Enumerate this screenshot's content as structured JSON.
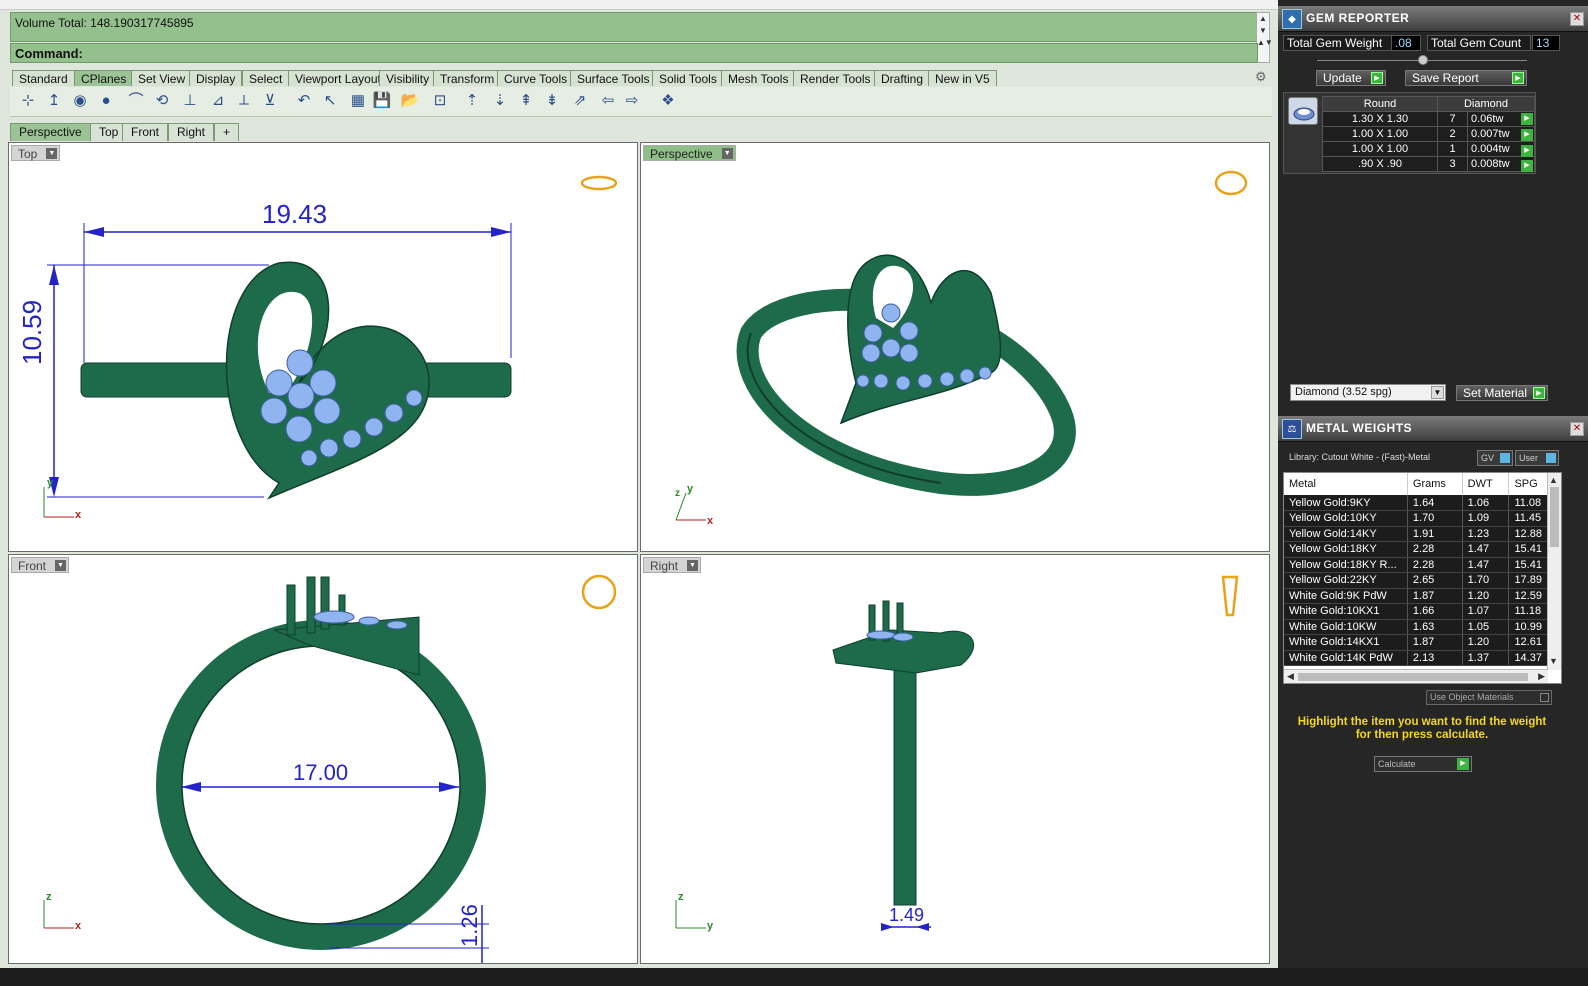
{
  "command": {
    "history": "Volume Total: 148.190317745895",
    "prompt": "Command:"
  },
  "toolbar_tabs": [
    "Standard",
    "CPlanes",
    "Set View",
    "Display",
    "Select",
    "Viewport Layout",
    "Visibility",
    "Transform",
    "Curve Tools",
    "Surface Tools",
    "Solid Tools",
    "Mesh Tools",
    "Render Tools",
    "Drafting",
    "New in V5"
  ],
  "toolbar_active": "CPlanes",
  "viewport_tabs": [
    "Perspective",
    "Top",
    "Front",
    "Right"
  ],
  "viewport_add": "+",
  "viewports": {
    "top": {
      "label": "Top",
      "dim_width": "19.43",
      "dim_height": "10.59",
      "axis_a": "y",
      "axis_b": "x"
    },
    "perspective": {
      "label": "Perspective",
      "axis_a": "z",
      "axis_b": "y",
      "axis_c": "x"
    },
    "front": {
      "label": "Front",
      "dim_inner": "17.00",
      "dim_band": "1.26",
      "axis_a": "z",
      "axis_b": "x"
    },
    "right": {
      "label": "Right",
      "dim_width": "1.49",
      "axis_a": "z",
      "axis_b": "y"
    }
  },
  "colors": {
    "metal": "#1e6b4b",
    "gem": "#8fb4f0",
    "dimension": "#2323c8",
    "panel": "#262626",
    "accent_green": "#3fb33f",
    "hint_yellow": "#f4d81b"
  },
  "gem_reporter": {
    "title": "GEM REPORTER",
    "total_weight_label": "Total Gem Weight",
    "total_weight": ".08",
    "total_count_label": "Total Gem Count",
    "total_count": "13",
    "update_label": "Update",
    "save_report_label": "Save Report",
    "table_head": [
      "Round",
      "Diamond"
    ],
    "rows": [
      {
        "size": "1.30 X 1.30",
        "count": "7",
        "weight": "0.06tw"
      },
      {
        "size": "1.00 X 1.00",
        "count": "2",
        "weight": "0.007tw"
      },
      {
        "size": "1.00 X 1.00",
        "count": "1",
        "weight": "0.004tw"
      },
      {
        "size": ".90 X .90",
        "count": "3",
        "weight": "0.008tw"
      }
    ],
    "material": "Diamond    (3.52 spg)",
    "set_material_label": "Set Material"
  },
  "metal_weights": {
    "title": "METAL WEIGHTS",
    "library": "Library: Cutout White - (Fast)-Metal",
    "gv_label": "GV",
    "user_label": "User",
    "columns": [
      "Metal",
      "Grams",
      "DWT",
      "SPG"
    ],
    "rows": [
      [
        "Yellow Gold:9KY",
        "1.64",
        "1.06",
        "11.08"
      ],
      [
        "Yellow Gold:10KY",
        "1.70",
        "1.09",
        "11.45"
      ],
      [
        "Yellow Gold:14KY",
        "1.91",
        "1.23",
        "12.88"
      ],
      [
        "Yellow Gold:18KY",
        "2.28",
        "1.47",
        "15.41"
      ],
      [
        "Yellow Gold:18KY R...",
        "2.28",
        "1.47",
        "15.41"
      ],
      [
        "Yellow Gold:22KY",
        "2.65",
        "1.70",
        "17.89"
      ],
      [
        "White Gold:9K PdW",
        "1.87",
        "1.20",
        "12.59"
      ],
      [
        "White Gold:10KX1",
        "1.66",
        "1.07",
        "11.18"
      ],
      [
        "White Gold:10KW",
        "1.63",
        "1.05",
        "10.99"
      ],
      [
        "White Gold:14KX1",
        "1.87",
        "1.20",
        "12.61"
      ],
      [
        "White Gold:14K PdW",
        "2.13",
        "1.37",
        "14.37"
      ]
    ],
    "use_object_label": "Use Object Materials",
    "hint": "Highlight the item you want to find the weight for then press calculate.",
    "calculate_label": "Calculate"
  }
}
